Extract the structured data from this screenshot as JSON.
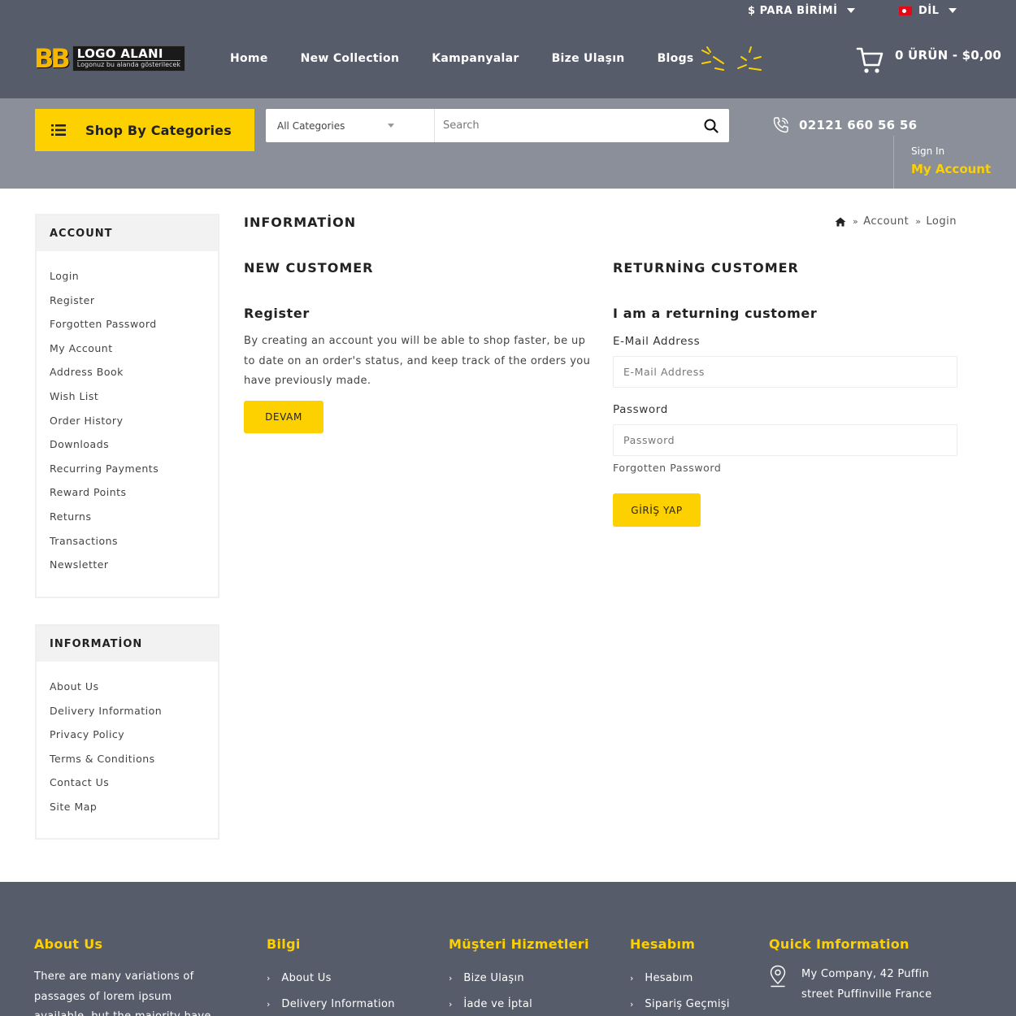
{
  "colors": {
    "accent": "#fdd000",
    "header_bg": "#575c6b",
    "bar_bg": "#8a8f99"
  },
  "topmeta": {
    "currency_label": "$  PARA BİRİMİ",
    "language_label": "DİL"
  },
  "logo": {
    "bb": "BB",
    "title": "LOGO ALANI",
    "subtitle": "Logonuz bu alanda gösterilecek"
  },
  "nav": [
    {
      "label": "Home"
    },
    {
      "label": "New Collection"
    },
    {
      "label": "Kampanyalar"
    },
    {
      "label": "Bize Ulaşın"
    },
    {
      "label": "Blogs"
    }
  ],
  "cart": {
    "label": "0 ÜRÜN - $0,00"
  },
  "shop_categories": {
    "label": "Shop By Categories"
  },
  "search": {
    "category": "All Categories",
    "placeholder": "Search"
  },
  "phone": {
    "number": "02121 660 56 56"
  },
  "account_header": {
    "sign_in": "Sign In",
    "my_account": "My Account"
  },
  "sidebar": {
    "account": {
      "title": "ACCOUNT",
      "items": [
        "Login",
        "Register",
        "Forgotten Password",
        "My Account",
        "Address Book",
        "Wish List",
        "Order History",
        "Downloads",
        "Recurring Payments",
        "Reward Points",
        "Returns",
        "Transactions",
        "Newsletter"
      ]
    },
    "information": {
      "title": "INFORMATİON",
      "items": [
        "About Us",
        "Delivery Information",
        "Privacy Policy",
        "Terms & Conditions",
        "Contact Us",
        "Site Map"
      ]
    }
  },
  "main": {
    "title": "INFORMATİON",
    "breadcrumb": {
      "account": "Account",
      "current": "Login"
    },
    "new_customer": {
      "heading": "NEW CUSTOMER",
      "subheading": "Register",
      "text": "By creating an account you will be able to shop faster, be up to date on an order's status, and keep track of the orders you have previously made.",
      "button": "DEVAM"
    },
    "returning_customer": {
      "heading": "RETURNİNG CUSTOMER",
      "subheading": "I am a returning customer",
      "email_label": "E-Mail Address",
      "email_placeholder": "E-Mail Address",
      "password_label": "Password",
      "password_placeholder": "Password",
      "forgotten": "Forgotten Password",
      "button": "GİRİŞ YAP"
    }
  },
  "footer": {
    "about": {
      "title": "About Us",
      "text": "There are many variations of passages of lorem ipsum available, but the majority have"
    },
    "bilgi": {
      "title": "Bilgi",
      "items": [
        "About Us",
        "Delivery Information"
      ]
    },
    "musteri": {
      "title": "Müşteri Hizmetleri",
      "items": [
        "Bize Ulaşın",
        "İade ve İptal"
      ]
    },
    "hesabim": {
      "title": "Hesabım",
      "items": [
        "Hesabım",
        "Sipariş Geçmişi"
      ]
    },
    "quick": {
      "title": "Quick Imformation",
      "address": "My Company, 42 Puffin street Puffinville France"
    }
  }
}
